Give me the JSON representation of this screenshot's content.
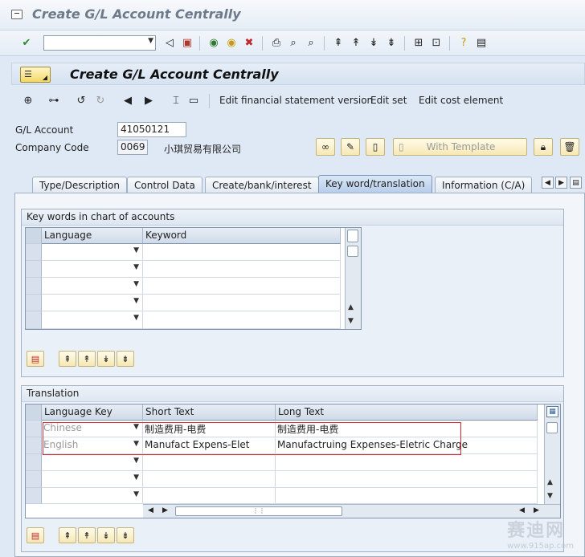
{
  "window": {
    "title": "Create G/L Account Centrally"
  },
  "system_toolbar": {
    "command_field_value": ""
  },
  "screen": {
    "title": "Create G/L Account Centrally"
  },
  "app_toolbar": {
    "edit_fs_version": "Edit financial statement version",
    "edit_set": "Edit set",
    "edit_cost_element": "Edit cost element"
  },
  "header": {
    "gl_account_label": "G/L Account",
    "gl_account_value": "41050121",
    "company_code_label": "Company Code",
    "company_code_value": "0069",
    "company_name": "小琪贸易有限公司",
    "with_template": "With Template"
  },
  "tabs": [
    {
      "label": "Type/Description",
      "active": false
    },
    {
      "label": "Control Data",
      "active": false
    },
    {
      "label": "Create/bank/interest",
      "active": false
    },
    {
      "label": "Key word/translation",
      "active": true
    },
    {
      "label": "Information (C/A)",
      "active": false
    }
  ],
  "keywords": {
    "group_title": "Key words in chart of accounts",
    "columns": [
      "Language",
      "Keyword"
    ],
    "rows": [
      {
        "language": "",
        "keyword": ""
      },
      {
        "language": "",
        "keyword": ""
      },
      {
        "language": "",
        "keyword": ""
      },
      {
        "language": "",
        "keyword": ""
      },
      {
        "language": "",
        "keyword": ""
      }
    ]
  },
  "translation": {
    "group_title": "Translation",
    "columns": [
      "Language Key",
      "Short Text",
      "Long Text"
    ],
    "rows": [
      {
        "language_key": "Chinese",
        "short_text": "制造费用-电费",
        "long_text": "制造费用-电费"
      },
      {
        "language_key": "English",
        "short_text": "Manufact Expens-Elet",
        "long_text": "Manufactruing Expenses-Eletric Charge"
      },
      {
        "language_key": "",
        "short_text": "",
        "long_text": ""
      },
      {
        "language_key": "",
        "short_text": "",
        "long_text": ""
      },
      {
        "language_key": "",
        "short_text": "",
        "long_text": ""
      }
    ]
  },
  "watermark": {
    "text": "赛迪网",
    "url": "www.915ap.com"
  },
  "colors": {
    "highlight": "#d6252b",
    "active_tab": "#b7cdea",
    "button": "#f6e8b4"
  }
}
